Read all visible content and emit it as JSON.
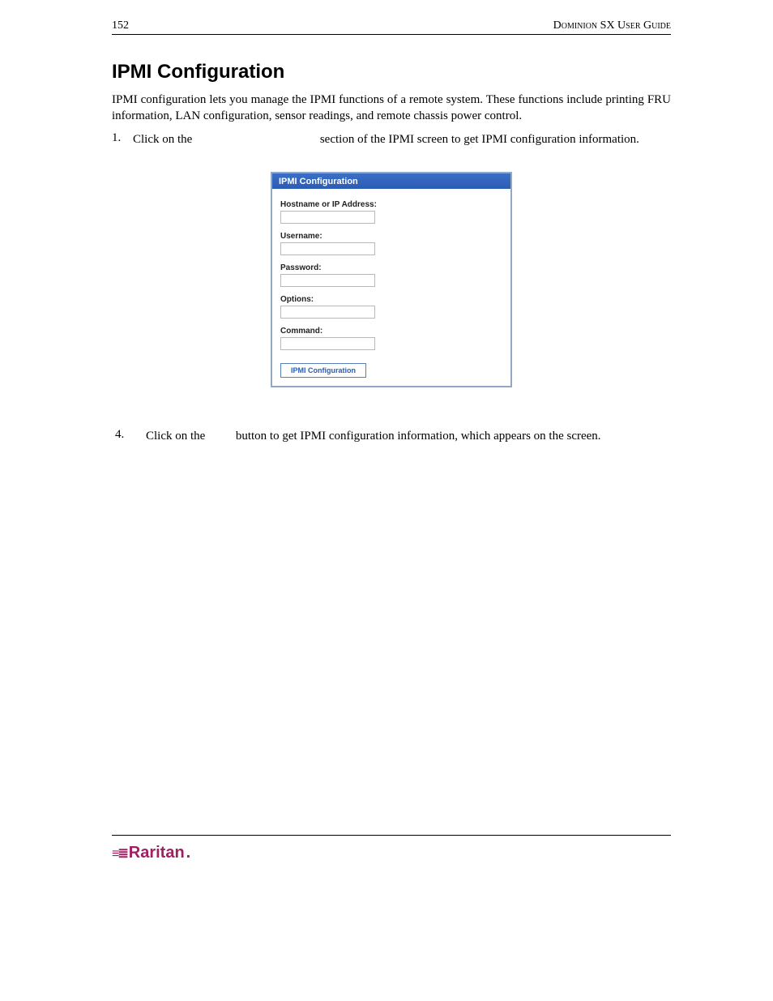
{
  "header": {
    "page_number": "152",
    "guide_title": "Dominion SX User Guide"
  },
  "title": "IPMI Configuration",
  "intro": "IPMI configuration lets you manage the IPMI functions of a remote system. These functions include printing FRU information, LAN configuration, sensor readings, and remote chassis power control.",
  "steps": [
    {
      "num": "1.",
      "prefix": "Click on the ",
      "suffix": " section of the IPMI screen to get IPMI configuration information."
    },
    {
      "num": "4.",
      "prefix": "Click on the ",
      "suffix": " button to get IPMI configuration information, which appears on the screen."
    }
  ],
  "screenshot": {
    "panel_title": "IPMI Configuration",
    "fields": {
      "hostname": "Hostname or IP Address:",
      "username": "Username:",
      "password": "Password:",
      "options": "Options:",
      "command": "Command:"
    },
    "button": "IPMI Configuration"
  },
  "footer": {
    "brand": "Raritan"
  }
}
